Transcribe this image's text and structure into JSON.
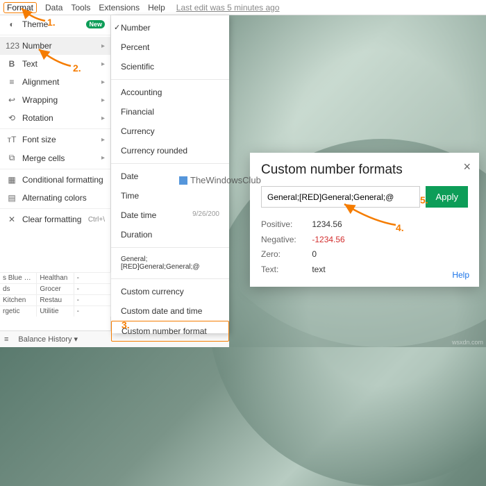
{
  "menubar": {
    "format": "Format",
    "data": "Data",
    "tools": "Tools",
    "extensions": "Extensions",
    "help": "Help",
    "edit_info": "Last edit was 5 minutes ago"
  },
  "sidebar": {
    "theme": "Theme",
    "new_badge": "New",
    "number": "Number",
    "text": "Text",
    "alignment": "Alignment",
    "wrapping": "Wrapping",
    "rotation": "Rotation",
    "font_size": "Font size",
    "merge_cells": "Merge cells",
    "conditional": "Conditional formatting",
    "alternating": "Alternating colors",
    "clear": "Clear formatting",
    "clear_shortcut": "Ctrl+\\"
  },
  "grid": {
    "rows": [
      [
        "s Blue Shield",
        "Healthan",
        "-"
      ],
      [
        "ds",
        "Grocer",
        "-"
      ],
      [
        "Kitchen",
        "Restau",
        "-"
      ],
      [
        "rgetic",
        "Utilitie",
        "-"
      ]
    ]
  },
  "tabbar": {
    "sheet1": "Balance History"
  },
  "submenu": {
    "number": "Number",
    "percent": "Percent",
    "scientific": "Scientific",
    "accounting": "Accounting",
    "financial": "Financial",
    "currency": "Currency",
    "currency_rounded": "Currency rounded",
    "date": "Date",
    "time": "Time",
    "datetime": "Date time",
    "datetime_ex": "9/26/200",
    "duration": "Duration",
    "generalred": "General;[RED]General;General;@",
    "custom_currency": "Custom currency",
    "custom_datetime": "Custom date and time",
    "custom_number": "Custom number format"
  },
  "dialog": {
    "title": "Custom number formats",
    "input_value": "General;[RED]General;General;@",
    "apply": "Apply",
    "positive_label": "Positive:",
    "positive_val": "1234.56",
    "negative_label": "Negative:",
    "negative_val": "-1234.56",
    "zero_label": "Zero:",
    "zero_val": "0",
    "text_label": "Text:",
    "text_val": "text",
    "help": "Help"
  },
  "annotations": {
    "n1": "1.",
    "n2": "2.",
    "n3": "3.",
    "n4": "4.",
    "n5": "5."
  },
  "watermark": "TheWindowsClub",
  "domain": "wsxdn.com"
}
